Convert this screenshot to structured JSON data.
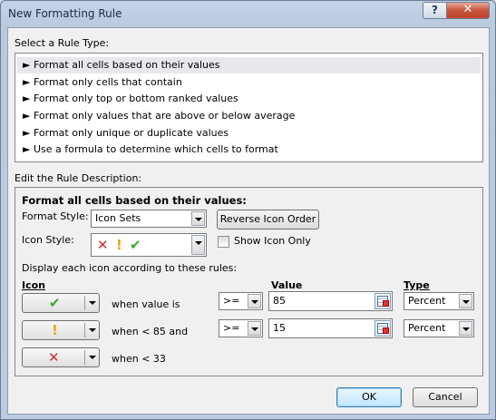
{
  "window": {
    "title": "New Formatting Rule",
    "help_label": "?",
    "close_label": "✕"
  },
  "rule_type": {
    "label": "Select a Rule Type:",
    "items": [
      "► Format all cells based on their values",
      "► Format only cells that contain",
      "► Format only top or bottom ranked values",
      "► Format only values that are above or below average",
      "► Format only unique or duplicate values",
      "► Use a formula to determine which cells to format"
    ],
    "selected_index": 0
  },
  "description": {
    "label": "Edit the Rule Description:",
    "heading": "Format all cells based on their values:",
    "format_style_label": "Format Style:",
    "format_style_value": "Icon Sets",
    "reverse_button": "Reverse Icon Order",
    "icon_style_label": "Icon Style:",
    "show_icon_only_label": "Show Icon Only",
    "show_icon_only_checked": false,
    "rules_intro": "Display each icon according to these rules:",
    "col_icon": "Icon",
    "col_value": "Value",
    "col_type": "Type",
    "rows": [
      {
        "icon": "check-icon",
        "condition": "when value is",
        "operator": ">=",
        "value": "85",
        "type": "Percent"
      },
      {
        "icon": "exclamation-icon",
        "condition": "when < 85 and",
        "operator": ">=",
        "value": "15",
        "type": "Percent"
      },
      {
        "icon": "cross-icon",
        "condition": "when < 33"
      }
    ]
  },
  "buttons": {
    "ok": "OK",
    "cancel": "Cancel"
  },
  "colors": {
    "check": "#3aa52b",
    "exclamation": "#f0a500",
    "cross": "#d0302a"
  }
}
